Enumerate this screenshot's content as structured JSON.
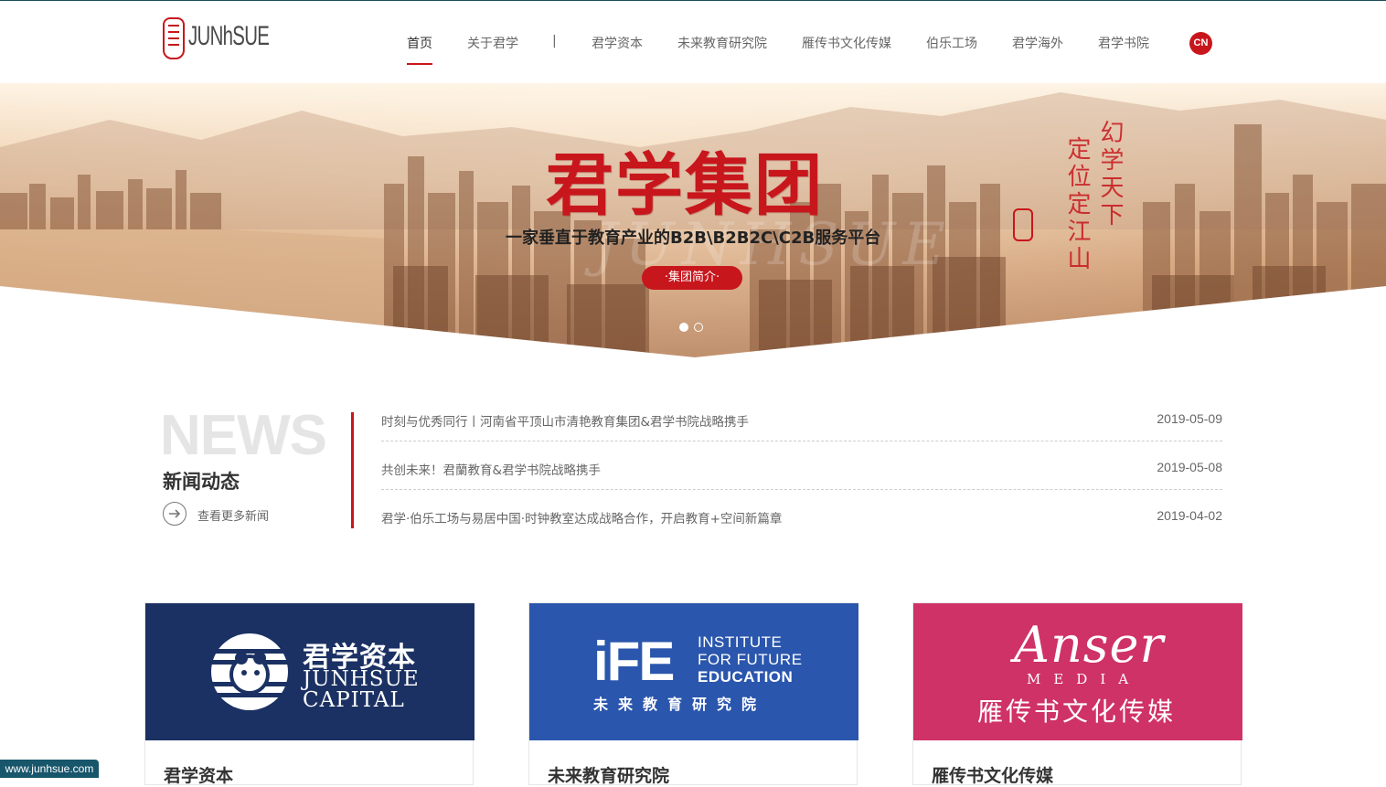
{
  "logo": {
    "text": "JUNhSUE"
  },
  "nav": {
    "items": [
      "首页",
      "关于君学",
      "|",
      "君学资本",
      "未来教育研究院",
      "雁传书文化传媒",
      "伯乐工场",
      "君学海外",
      "君学书院"
    ],
    "lang": "CN"
  },
  "banner": {
    "title": "君学集团",
    "subtitle": "一家垂直于教育产业的B2B\\B2B2C\\C2B服务平台",
    "button": "·集团简介·",
    "calligraphy_right": "幻学天下",
    "calligraphy_left": "定位定江山",
    "watermark": "JUNHSUE",
    "slides": 2,
    "active_slide": 1
  },
  "news": {
    "big": "NEWS",
    "title": "新闻动态",
    "more": "查看更多新闻",
    "items": [
      {
        "title": "时刻与优秀同行丨河南省平顶山市清艳教育集团&君学书院战略携手",
        "date": "2019-05-09"
      },
      {
        "title": "共创未来！君蘭教育&君学书院战略携手",
        "date": "2019-05-08"
      },
      {
        "title": "君学·伯乐工场与易居中国·时钟教室达成战略合作，开启教育+空间新篇章",
        "date": "2019-04-02"
      }
    ]
  },
  "cards": [
    {
      "label": "君学资本",
      "logo_cn": "君学资本",
      "logo_en1": "JUNHSUE",
      "logo_en2": "CAPITAL",
      "color": "#1b3163"
    },
    {
      "label": "未来教育研究院",
      "logo_mark": "iFE",
      "logo_l1": "INSTITUTE",
      "logo_l2": "FOR FUTURE",
      "logo_l3": "EDUCATION",
      "logo_cn": "未来教育研究院",
      "color": "#2a56ad"
    },
    {
      "label": "雁传书文化传媒",
      "logo_en": "Anser",
      "logo_sub": "MEDIA",
      "logo_cn": "雁传书文化传媒",
      "color": "#cf3266"
    }
  ],
  "footer_badge": "www.junhsue.com",
  "colors": {
    "accent": "#c8161d"
  }
}
